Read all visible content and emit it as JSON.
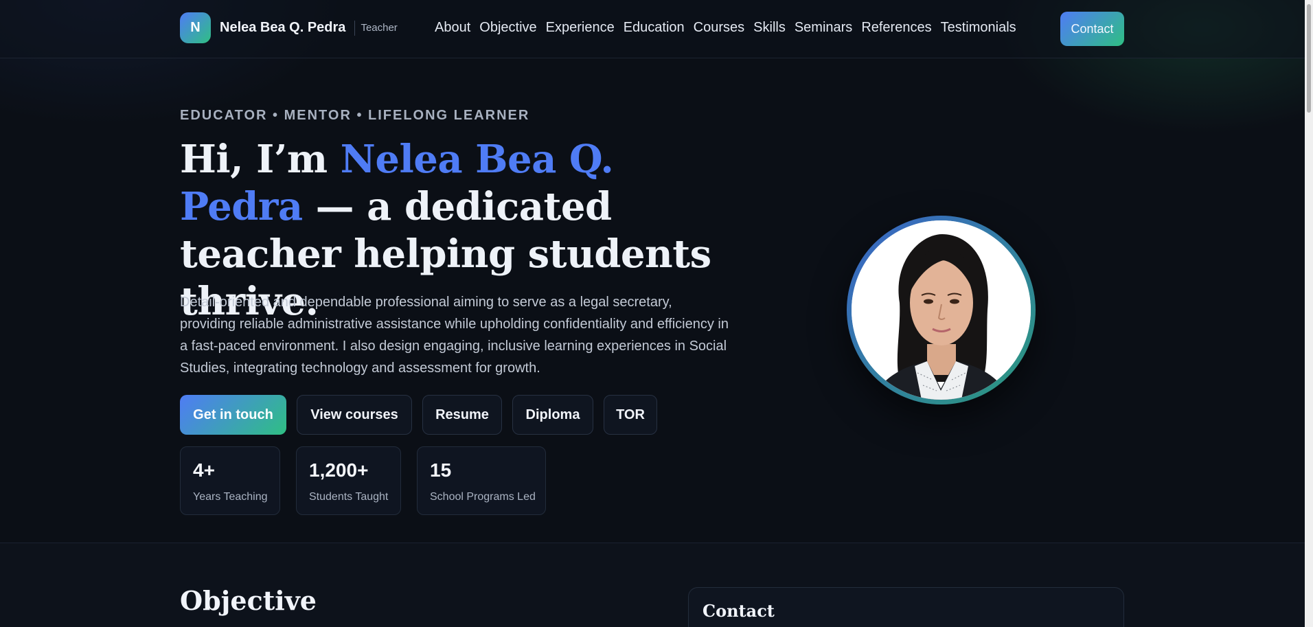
{
  "nav": {
    "logo_letter": "N",
    "brand_name": "Nelea Bea Q. Pedra",
    "brand_role": "Teacher",
    "links": [
      "About",
      "Objective",
      "Experience",
      "Education",
      "Courses",
      "Skills",
      "Seminars",
      "References",
      "Testimonials"
    ],
    "contact_label": "Contact"
  },
  "hero": {
    "eyebrow": "EDUCATOR • MENTOR • LIFELONG LEARNER",
    "headline_pre": "Hi, I’m ",
    "headline_name": "Nelea Bea Q. Pedra",
    "headline_post": " — a dedicated teacher helping students thrive.",
    "intro": "Detail-oriented and dependable professional aiming to serve as a legal secretary, providing reliable administrative assistance while upholding confidentiality and efficiency in a fast-paced environment. I also design engaging, inclusive learning experiences in Social Studies, integrating technology and assessment for growth.",
    "buttons": {
      "get_in_touch": "Get in touch",
      "view_courses": "View courses",
      "resume": "Resume",
      "diploma": "Diploma",
      "tor": "TOR"
    },
    "stats": [
      {
        "value": "4+",
        "label": "Years Teaching"
      },
      {
        "value": "1,200+",
        "label": "Students Taught"
      },
      {
        "value": "15",
        "label": "School Programs Led"
      }
    ]
  },
  "objective": {
    "title": "Objective"
  },
  "contact_card": {
    "title": "Contact"
  },
  "colors": {
    "accent_blue": "#4f7cf5",
    "accent_green": "#2fbf83",
    "background": "#0b0f16"
  }
}
